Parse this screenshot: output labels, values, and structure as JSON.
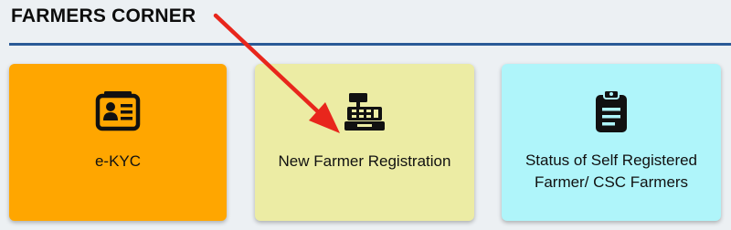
{
  "section": {
    "title": "FARMERS CORNER"
  },
  "cards": [
    {
      "label": "e-KYC",
      "icon": "id-card-icon",
      "color": "#ffa600"
    },
    {
      "label": "New Farmer Registration",
      "icon": "cash-register-icon",
      "color": "#ececa4"
    },
    {
      "label_line1": "Status of Self Registered",
      "label_line2": "Farmer/ CSC Farmers",
      "icon": "clipboard-icon",
      "color": "#aff5fa"
    }
  ],
  "accents": {
    "rule_color": "#2a5a96",
    "arrow_color": "#e8261c"
  }
}
